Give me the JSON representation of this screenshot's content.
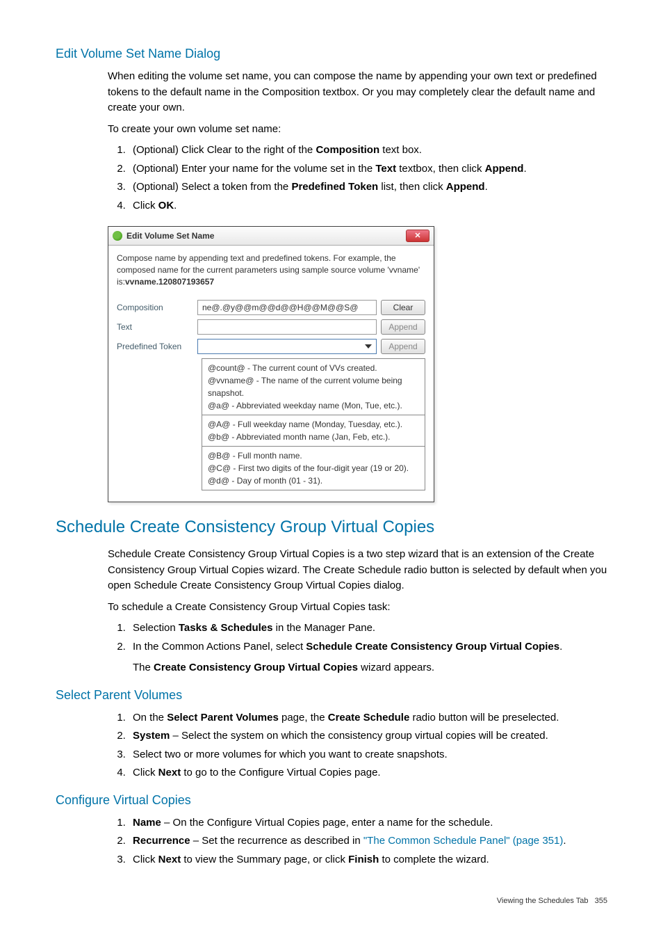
{
  "section1": {
    "title": "Edit Volume Set Name Dialog",
    "p1": "When editing the volume set name, you can compose the name by appending your own text or predefined tokens to the default name in the Composition textbox. Or you may completely clear the default name and create your own.",
    "p2": "To create your own volume set name:",
    "steps": {
      "s1a": "(Optional) Click Clear to the right of the ",
      "s1b_bold": "Composition",
      "s1c": " text box.",
      "s2a": "(Optional) Enter your name for the volume set in the ",
      "s2b_bold": "Text",
      "s2c": " textbox, then click ",
      "s2d_bold": "Append",
      "s2e": ".",
      "s3a": "(Optional) Select a token from the ",
      "s3b_bold": "Predefined Token",
      "s3c": " list, then click ",
      "s3d_bold": "Append",
      "s3e": ".",
      "s4a": "Click ",
      "s4b_bold": "OK",
      "s4c": "."
    }
  },
  "dialog": {
    "title": "Edit Volume Set Name",
    "close_symbol": "✕",
    "desc_prefix": "Compose name by appending text and predefined tokens. For example, the composed name for the current parameters using sample source volume 'vvname' is:",
    "desc_bold": "vvname.120807193657",
    "labels": {
      "composition": "Composition",
      "text": "Text",
      "predefined": "Predefined Token"
    },
    "composition_value": "ne@.@y@@m@@d@@H@@M@@S@",
    "btn_clear": "Clear",
    "btn_append1": "Append",
    "btn_append2": "Append",
    "tokens": {
      "g1": "@count@ - The current count of VVs created.\n@vvname@ - The name of the current volume being snapshot.\n@a@ - Abbreviated weekday name (Mon, Tue, etc.).",
      "g2": "@A@ - Full weekday name (Monday, Tuesday, etc.).\n@b@ - Abbreviated month name (Jan, Feb, etc.).",
      "g3": "@B@ - Full month name.\n@C@ - First two digits of the four-digit year (19 or 20).\n@d@ - Day of month (01 - 31)."
    }
  },
  "section2": {
    "title": "Schedule Create Consistency Group Virtual Copies",
    "p1": "Schedule Create Consistency Group Virtual Copies is a two step wizard that is an extension of the Create Consistency Group Virtual Copies wizard. The Create Schedule radio button is selected by default when you open Schedule Create Consistency Group Virtual Copies dialog.",
    "p2": "To schedule a Create Consistency Group Virtual Copies task:",
    "steps": {
      "s1a": "Selection ",
      "s1b_bold": "Tasks & Schedules",
      "s1c": " in the Manager Pane.",
      "s2a": "In the Common Actions Panel, select ",
      "s2b_bold": "Schedule Create Consistency Group Virtual Copies",
      "s2c": ".",
      "s2d_a": "The ",
      "s2d_bold": "Create Consistency Group Virtual Copies",
      "s2d_c": " wizard appears."
    }
  },
  "section3": {
    "title": "Select Parent Volumes",
    "steps": {
      "s1a": "On the ",
      "s1b_bold": "Select Parent Volumes",
      "s1c": " page, the ",
      "s1d_bold": "Create Schedule",
      "s1e": " radio button will be preselected.",
      "s2a_bold": "System",
      "s2b": " – Select the system on which the consistency group virtual copies will be created.",
      "s3": "Select two or more volumes for which you want to create snapshots.",
      "s4a": "Click ",
      "s4b_bold": "Next",
      "s4c": " to go to the Configure Virtual Copies page."
    }
  },
  "section4": {
    "title": "Configure Virtual Copies",
    "steps": {
      "s1a_bold": "Name",
      "s1b": " – On the Configure Virtual Copies page, enter a name for the schedule.",
      "s2a_bold": "Recurrence",
      "s2b": " – Set the recurrence as described in ",
      "s2c_link": "\"The Common Schedule Panel\" (page 351)",
      "s2d": ".",
      "s3a": "Click ",
      "s3b_bold": "Next",
      "s3c": " to view the Summary page, or click ",
      "s3d_bold": "Finish",
      "s3e": " to complete the wizard."
    }
  },
  "footer": {
    "text": "Viewing the Schedules Tab",
    "page": "355"
  }
}
